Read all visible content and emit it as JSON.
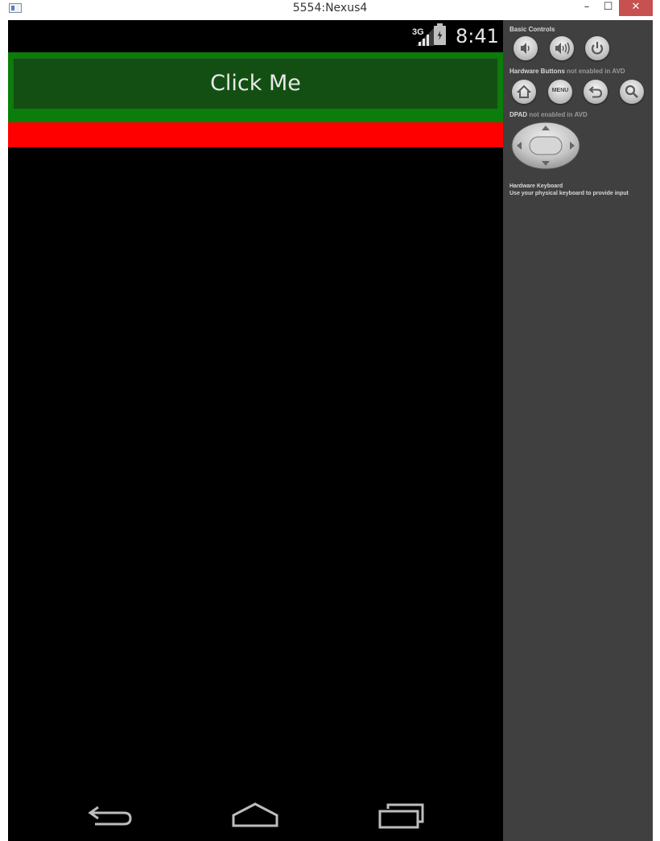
{
  "window": {
    "title": "5554:Nexus4",
    "minimize": "–",
    "maximize": "☐",
    "close": "✕"
  },
  "status_bar": {
    "network": "3G",
    "time": "8:41"
  },
  "app": {
    "button_label": "Click Me",
    "colors": {
      "container": "#0a7d0a",
      "button": "#134f13",
      "bar": "#ff0000"
    }
  },
  "nav_bar": {
    "icons": [
      "back-icon",
      "home-icon",
      "recent-apps-icon"
    ]
  },
  "controls": {
    "basic_controls": "Basic Controls",
    "hardware_buttons": "Hardware Buttons",
    "hardware_buttons_note": "not enabled in AVD",
    "menu_label": "MENU",
    "dpad": "DPAD",
    "dpad_note": "not enabled in AVD",
    "hardware_keyboard": "Hardware Keyboard",
    "keyboard_hint": "Use your physical keyboard to provide input"
  }
}
